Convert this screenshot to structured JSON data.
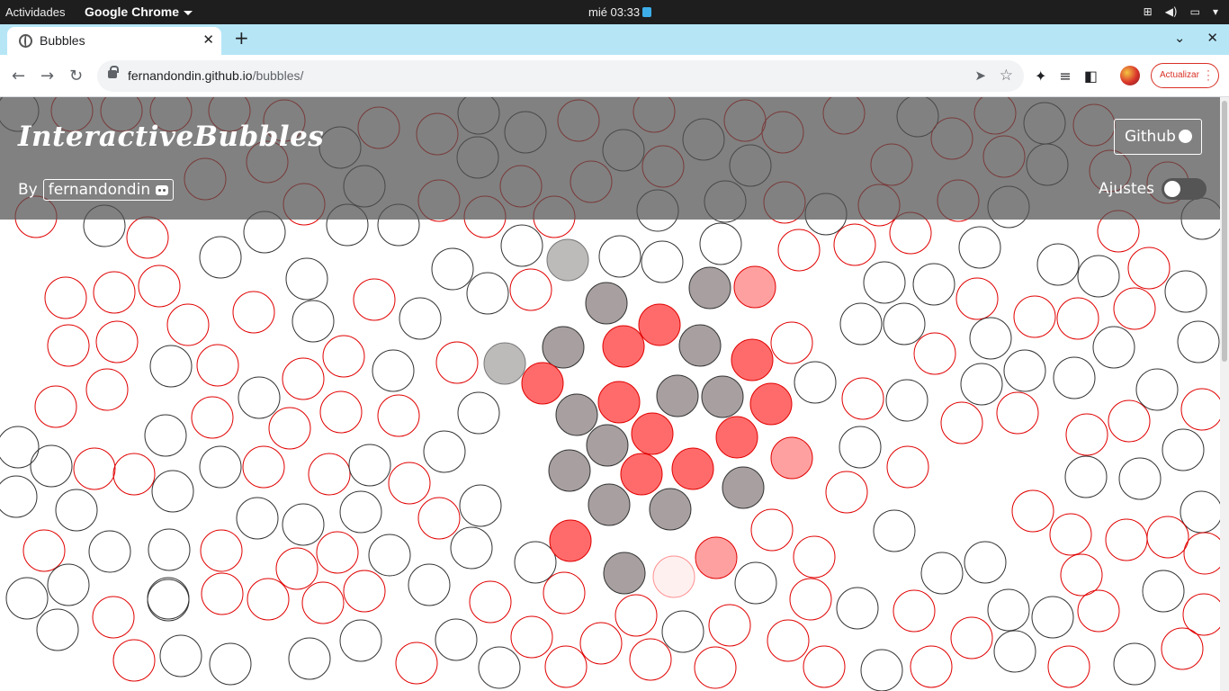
{
  "os_topbar": {
    "activities": "Actividades",
    "app_menu": "Google Chrome",
    "clock": "mié 03:33",
    "tray_icons": [
      "network-icon",
      "volume-icon",
      "battery-icon",
      "system-menu-caret-icon"
    ]
  },
  "browser": {
    "tab_title": "Bubbles",
    "url_domain": "fernandondin.github.io",
    "url_path": "/bubbles/",
    "update_label": "Actualizar"
  },
  "page": {
    "brand": "InteractiveBubbles",
    "by_label": "By",
    "author": "fernandondin",
    "github_label": "Github",
    "settings_label": "Ajustes",
    "settings_enabled": false
  },
  "colors": {
    "tab_strip": "#b6e6f6",
    "bubble_red_stroke": "#e00000",
    "bubble_dark_stroke": "#333333",
    "active_red_fill": "#ff6b6b",
    "active_gray_fill": "#a8a0a0",
    "header_overlay": "rgba(80,80,80,0.72)"
  }
}
